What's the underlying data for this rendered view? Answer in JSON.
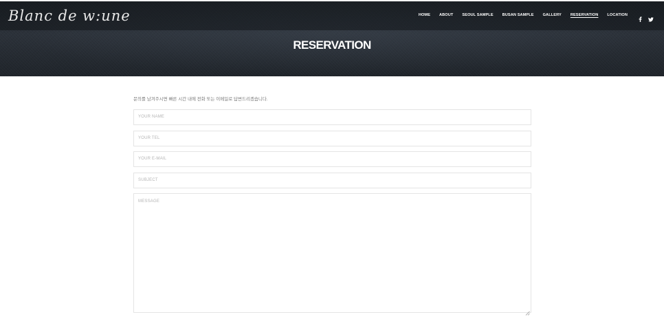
{
  "header": {
    "logo_text": "Blanc de w:une",
    "nav_items": [
      {
        "label": "HOME",
        "active": false
      },
      {
        "label": "ABOUT",
        "active": false
      },
      {
        "label": "SEOUL SAMPLE",
        "active": false
      },
      {
        "label": "BUSAN SAMPLE",
        "active": false
      },
      {
        "label": "GALLERY",
        "active": false
      },
      {
        "label": "RESERVATION",
        "active": true
      },
      {
        "label": "LOCATION",
        "active": false
      }
    ],
    "social_icons": [
      "facebook-icon",
      "twitter-icon"
    ]
  },
  "hero": {
    "title": "RESERVATION"
  },
  "form": {
    "intro": "문의를 남겨주시면 빠른 시간 내에 전화 또는 이메일로 답변드리겠습니다.",
    "name_placeholder": "YOUR NAME",
    "tel_placeholder": "YOUR TEL",
    "email_placeholder": "YOUR E-MAIL",
    "subject_placeholder": "SUBJECT",
    "message_placeholder": "MESSAGE"
  }
}
